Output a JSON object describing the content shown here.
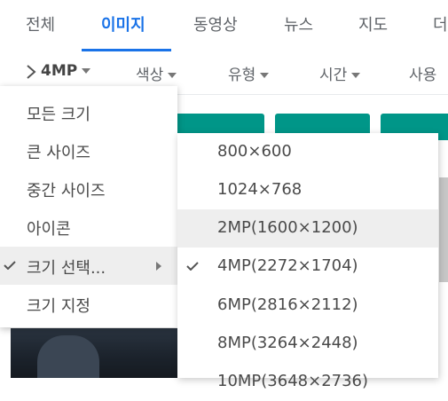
{
  "tabs": {
    "items": [
      {
        "label": "전체"
      },
      {
        "label": "이미지"
      },
      {
        "label": "동영상"
      },
      {
        "label": "뉴스"
      },
      {
        "label": "지도"
      },
      {
        "label": "더"
      }
    ],
    "active_index": 1
  },
  "filters": {
    "current": "4MP",
    "items": [
      {
        "label": "색상"
      },
      {
        "label": "유형"
      },
      {
        "label": "시간"
      },
      {
        "label": "사용"
      }
    ]
  },
  "size_menu": {
    "items": [
      {
        "label": "모든 크기"
      },
      {
        "label": "큰 사이즈"
      },
      {
        "label": "중간 사이즈"
      },
      {
        "label": "아이콘"
      },
      {
        "label": "크기 선택..."
      },
      {
        "label": "크기 지정"
      }
    ],
    "checked_index": 4,
    "submenu_index": 4
  },
  "size_submenu": {
    "items": [
      {
        "label": "800×600"
      },
      {
        "label": "1024×768"
      },
      {
        "label": "2MP(1600×1200)"
      },
      {
        "label": "4MP(2272×1704)"
      },
      {
        "label": "6MP(2816×2112)"
      },
      {
        "label": "8MP(3264×2448)"
      },
      {
        "label": "10MP(3648×2736)"
      }
    ],
    "hovered_index": 2,
    "checked_index": 3
  },
  "colors": {
    "accent": "#1a73e8",
    "thumbnail_teal": "#009688",
    "hover_bg": "#eeeeee"
  }
}
